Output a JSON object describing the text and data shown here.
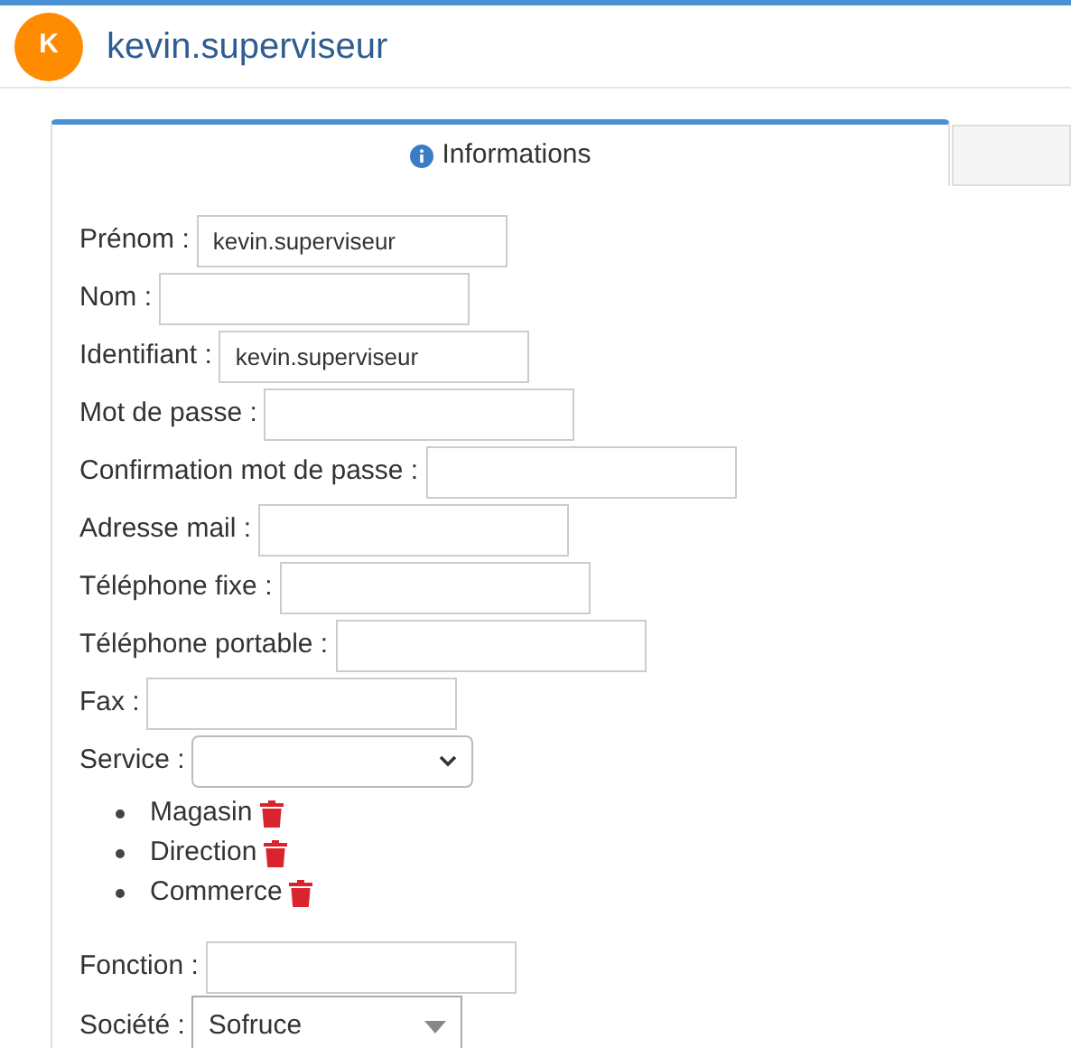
{
  "header": {
    "avatar": "K",
    "username": "kevin.superviseur"
  },
  "tabs": [
    {
      "label": "Informations",
      "selected": true
    },
    {
      "selected": false
    }
  ],
  "fields": [
    {
      "kind": "text",
      "label": "Prénom :",
      "value": "kevin.superviseur"
    },
    {
      "kind": "text",
      "label": "Nom :"
    },
    {
      "kind": "text",
      "label": "Identifiant :",
      "value": "kevin.superviseur"
    },
    {
      "kind": "text",
      "label": "Mot de passe :"
    },
    {
      "kind": "text",
      "label": "Confirmation mot de passe :"
    },
    {
      "kind": "text",
      "label": "Adresse mail :"
    },
    {
      "kind": "text",
      "label": "Téléphone fixe :"
    },
    {
      "kind": "text",
      "label": "Téléphone portable :"
    },
    {
      "kind": "text",
      "label": "Fax :"
    },
    {
      "kind": "select",
      "label": "Service :"
    },
    {
      "kind": "list",
      "items": [
        "Magasin",
        "Direction",
        "Commerce"
      ]
    },
    {
      "kind": "text",
      "label": "Fonction :"
    },
    {
      "kind": "combo",
      "label": "Société :",
      "value": "Sofruce"
    }
  ]
}
